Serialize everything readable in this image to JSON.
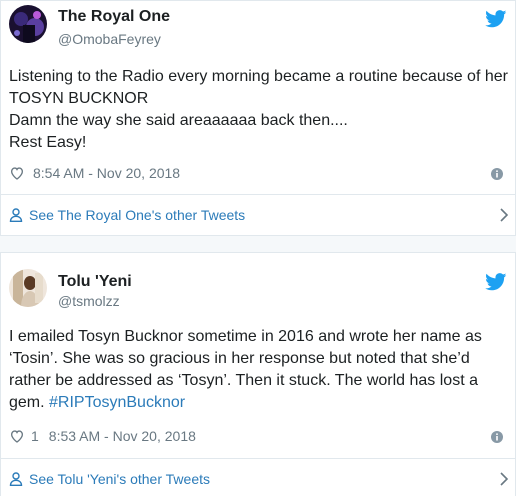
{
  "tweets": [
    {
      "name": "The Royal One",
      "handle": "@OmobaFeyrey",
      "text": "Listening to the Radio every morning became a routine because of her TOSYN BUCKNOR\nDamn the way she said areaaaaaa back then....\nRest Easy!",
      "likes": "",
      "time": "8:54 AM - Nov 20, 2018",
      "footer_link": "See The Royal One's other Tweets",
      "icons": {
        "logo": "twitter-bird-icon",
        "like": "heart-icon",
        "info": "info-icon",
        "person": "person-icon",
        "chevron": "chevron-right-icon"
      }
    },
    {
      "name": "Tolu 'Yeni",
      "handle": "@tsmolzz",
      "text_main": "I emailed Tosyn Bucknor sometime in 2016 and wrote her name as ‘Tosin’. She was so gracious in her response but noted that she’d rather be addressed as ‘Tosyn’. Then it stuck. The world has lost a gem. ",
      "hashtag": "#RIPTosynBucknor",
      "likes": "1",
      "time": "8:53 AM - Nov 20, 2018",
      "footer_link": "See Tolu 'Yeni's other Tweets",
      "icons": {
        "logo": "twitter-bird-icon",
        "like": "heart-icon",
        "info": "info-icon",
        "person": "person-icon",
        "chevron": "chevron-right-icon"
      }
    }
  ],
  "colors": {
    "link": "#2b7bb9",
    "bird": "#1da1f2",
    "muted": "#697882",
    "border": "#e1e8ed",
    "text": "#1c2022"
  }
}
